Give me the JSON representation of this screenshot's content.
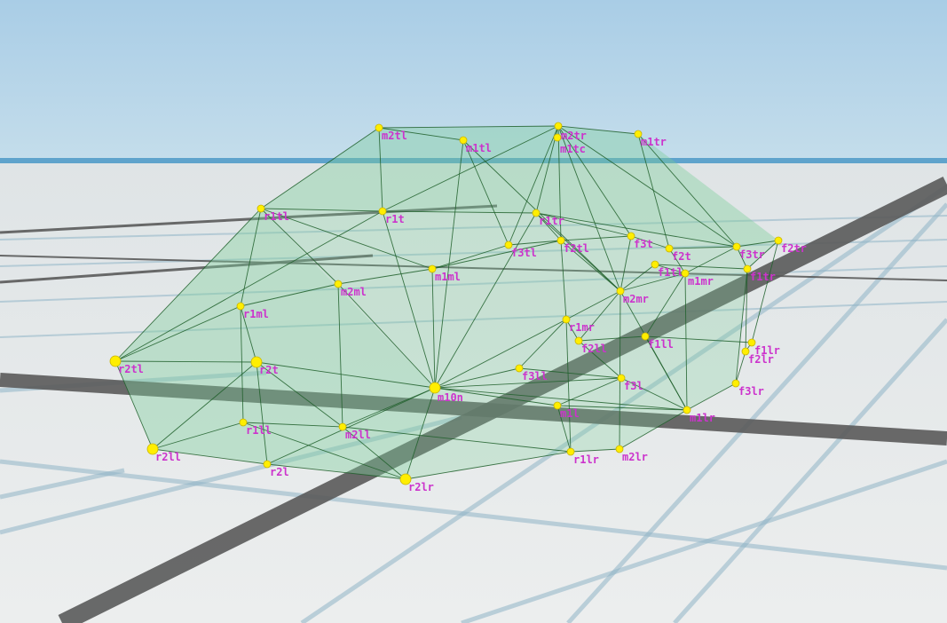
{
  "scene": {
    "label_color": "#cc33cc",
    "node_color": "#ffee00",
    "beam_color": "#1f5f2a",
    "panel_color": "#7fcf9a",
    "sky_top": "#a8cde6",
    "sky_bottom": "#c2dcec",
    "horizon_color": "#5fa3cc",
    "ground_color": "#e6e8e9",
    "grid_dark": "#5a5a5a",
    "grid_light": "#8fb4c6"
  },
  "nodes": [
    {
      "id": "m2tl",
      "label": "m2tl"
    },
    {
      "id": "m1tl",
      "label": "m1tl"
    },
    {
      "id": "m2tr",
      "label": "m2tr"
    },
    {
      "id": "m1tc",
      "label": "m1tc"
    },
    {
      "id": "m1tr",
      "label": "m1tr"
    },
    {
      "id": "r1tl",
      "label": "r1tl"
    },
    {
      "id": "r1t",
      "label": "r1t"
    },
    {
      "id": "r1tr",
      "label": "r1tr"
    },
    {
      "id": "f3tl",
      "label": "f3tl"
    },
    {
      "id": "f2tl",
      "label": "f2tl"
    },
    {
      "id": "f3t",
      "label": "f3t"
    },
    {
      "id": "f2t",
      "label": "f2t"
    },
    {
      "id": "f3tr",
      "label": "f3tr"
    },
    {
      "id": "f2tr",
      "label": "f2tr"
    },
    {
      "id": "f1tl",
      "label": "f1tl"
    },
    {
      "id": "f1tr",
      "label": "f1tr"
    },
    {
      "id": "m1ml",
      "label": "m1ml"
    },
    {
      "id": "m2ml",
      "label": "m2ml"
    },
    {
      "id": "m1mr",
      "label": "m1mr"
    },
    {
      "id": "m2mr",
      "label": "m2mr"
    },
    {
      "id": "r1ml",
      "label": "r1ml"
    },
    {
      "id": "r1mr",
      "label": "r1mr"
    },
    {
      "id": "f2ll",
      "label": "f2ll"
    },
    {
      "id": "f1ll",
      "label": "f1ll"
    },
    {
      "id": "f1lr",
      "label": "f1lr"
    },
    {
      "id": "f2lr",
      "label": "f2lr"
    },
    {
      "id": "r2tl",
      "label": "r2tl"
    },
    {
      "id": "r2t",
      "label": "r2t"
    },
    {
      "id": "f3ll",
      "label": "f3ll"
    },
    {
      "id": "m10n",
      "label": "m10n"
    },
    {
      "id": "f3l",
      "label": "f3l"
    },
    {
      "id": "f3lr",
      "label": "f3lr"
    },
    {
      "id": "m1l",
      "label": "m1l"
    },
    {
      "id": "m1lr",
      "label": "m1lr"
    },
    {
      "id": "r1ll",
      "label": "r1ll"
    },
    {
      "id": "m2ll",
      "label": "m2ll"
    },
    {
      "id": "r2ll",
      "label": "r2ll"
    },
    {
      "id": "r2l",
      "label": "r2l"
    },
    {
      "id": "r2lr",
      "label": "r2lr"
    },
    {
      "id": "r1lr",
      "label": "r1lr"
    },
    {
      "id": "m2lr",
      "label": "m2lr"
    }
  ],
  "beams": [
    [
      "m2tl",
      "m2tr"
    ],
    [
      "m2tl",
      "m1tl"
    ],
    [
      "m2tr",
      "m1tr"
    ],
    [
      "m2tl",
      "r1tl"
    ],
    [
      "m2tl",
      "r1t"
    ],
    [
      "m2tr",
      "r1t"
    ],
    [
      "m2tr",
      "r1tr"
    ],
    [
      "m2tr",
      "f2tl"
    ],
    [
      "m2tr",
      "f3tl"
    ],
    [
      "m2tr",
      "f3t"
    ],
    [
      "m2tr",
      "f3tr"
    ],
    [
      "m2tr",
      "m2mr"
    ],
    [
      "m1tr",
      "f3tr"
    ],
    [
      "m1tr",
      "f2t"
    ],
    [
      "m1tl",
      "f3tl"
    ],
    [
      "m1tl",
      "m10n"
    ],
    [
      "r1tl",
      "r1t"
    ],
    [
      "r1t",
      "r1tr"
    ],
    [
      "r1tr",
      "f3tr"
    ],
    [
      "r1tr",
      "f3t"
    ],
    [
      "r1tl",
      "r2tl"
    ],
    [
      "r1tl",
      "r1ml"
    ],
    [
      "r1tl",
      "m2ml"
    ],
    [
      "r1t",
      "m10n"
    ],
    [
      "r1tr",
      "m10n"
    ],
    [
      "r1tr",
      "m2mr"
    ],
    [
      "r1tr",
      "f2tl"
    ],
    [
      "f3tl",
      "f2tl"
    ],
    [
      "f2tl",
      "f3t"
    ],
    [
      "f3t",
      "f2t"
    ],
    [
      "f2t",
      "f3tr"
    ],
    [
      "f3tr",
      "f2tr"
    ],
    [
      "f2tr",
      "f1tr"
    ],
    [
      "f3tr",
      "f1tr"
    ],
    [
      "f3tr",
      "m1mr"
    ],
    [
      "f1tl",
      "f1tr"
    ],
    [
      "f1tl",
      "m1mr"
    ],
    [
      "f1tl",
      "m2mr"
    ],
    [
      "f2tl",
      "r1mr"
    ],
    [
      "f2tl",
      "m2mr"
    ],
    [
      "f3t",
      "m2mr"
    ],
    [
      "f2t",
      "m1mr"
    ],
    [
      "m1ml",
      "m2ml"
    ],
    [
      "m1ml",
      "r1tl"
    ],
    [
      "m1ml",
      "f3tl"
    ],
    [
      "m1ml",
      "m10n"
    ],
    [
      "m1ml",
      "f2tl"
    ],
    [
      "m2ml",
      "r1ml"
    ],
    [
      "m2ml",
      "m10n"
    ],
    [
      "m2ml",
      "m2ll"
    ],
    [
      "m1mr",
      "m2mr"
    ],
    [
      "m1mr",
      "f1ll"
    ],
    [
      "m1mr",
      "m1lr"
    ],
    [
      "m2mr",
      "r1mr"
    ],
    [
      "m2mr",
      "f2ll"
    ],
    [
      "m2mr",
      "m2lr"
    ],
    [
      "m2mr",
      "m1lr"
    ],
    [
      "r1ml",
      "r2tl"
    ],
    [
      "r1ml",
      "r2t"
    ],
    [
      "r1ml",
      "r1ll"
    ],
    [
      "r1mr",
      "m10n"
    ],
    [
      "r1mr",
      "f2ll"
    ],
    [
      "r1mr",
      "f3ll"
    ],
    [
      "r1mr",
      "r1lr"
    ],
    [
      "f2ll",
      "f1ll"
    ],
    [
      "f1ll",
      "f1lr"
    ],
    [
      "f1lr",
      "f2lr"
    ],
    [
      "f2lr",
      "f3lr"
    ],
    [
      "f2tr",
      "f1lr"
    ],
    [
      "f1tr",
      "f2lr"
    ],
    [
      "f1tr",
      "f3lr"
    ],
    [
      "f3lr",
      "m1lr"
    ],
    [
      "f1ll",
      "m1lr"
    ],
    [
      "f2ll",
      "f3l"
    ],
    [
      "f3ll",
      "f3l"
    ],
    [
      "f3ll",
      "m10n"
    ],
    [
      "f3l",
      "m1lr"
    ],
    [
      "f3l",
      "m1l"
    ],
    [
      "m1l",
      "m10n"
    ],
    [
      "m1l",
      "r1lr"
    ],
    [
      "m1l",
      "m1lr"
    ],
    [
      "r2tl",
      "r2t"
    ],
    [
      "r2tl",
      "r2ll"
    ],
    [
      "r2t",
      "r2ll"
    ],
    [
      "r2t",
      "r2l"
    ],
    [
      "r2t",
      "m10n"
    ],
    [
      "r2t",
      "m2ll"
    ],
    [
      "r1ll",
      "r2ll"
    ],
    [
      "r1ll",
      "m2ll"
    ],
    [
      "r1ll",
      "r2lr"
    ],
    [
      "m2ll",
      "m10n"
    ],
    [
      "m2ll",
      "r2lr"
    ],
    [
      "m2ll",
      "r1lr"
    ],
    [
      "r2ll",
      "r2l"
    ],
    [
      "r2l",
      "r2lr"
    ],
    [
      "r2lr",
      "r1lr"
    ],
    [
      "r1lr",
      "m2lr"
    ],
    [
      "m2lr",
      "m1lr"
    ],
    [
      "r2lr",
      "m10n"
    ],
    [
      "m10n",
      "f3l"
    ],
    [
      "m10n",
      "m1lr"
    ],
    [
      "r2l",
      "m10n"
    ],
    [
      "r2tl",
      "r1t"
    ],
    [
      "m1tl",
      "m2mr"
    ]
  ],
  "panels": [
    [
      "m2tl",
      "m2tr",
      "m1tr",
      "f2tr",
      "f1tr",
      "f3lr",
      "m1lr",
      "m2lr",
      "r1lr",
      "r2lr",
      "r2l",
      "r2ll",
      "r2tl",
      "r1tl"
    ],
    [
      "m2tl",
      "m2tr",
      "r1tr",
      "r1t",
      "r1tl"
    ],
    [
      "r1tl",
      "r2tl",
      "r2ll",
      "r2lr",
      "m10n"
    ],
    [
      "m2tr",
      "m1tr",
      "f2tr",
      "f3tr",
      "r1tr"
    ]
  ]
}
